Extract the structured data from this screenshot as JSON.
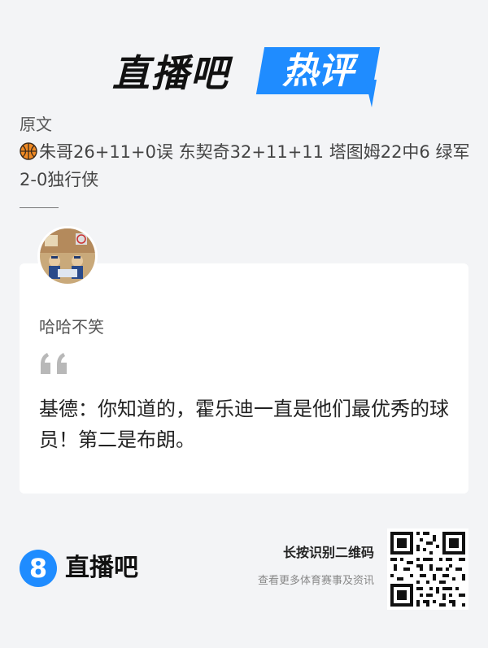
{
  "header": {
    "logo_left": "直播吧",
    "logo_right": "热评"
  },
  "original": {
    "label": "原文",
    "body": "朱哥26+11+0误 东契奇32+11+11 塔图姆22中6 绿军2-0独行侠",
    "icon": "basketball-icon"
  },
  "card": {
    "username": "哈哈不笑",
    "quote_icon": "quote-icon",
    "comment": "基德：你知道的，霍乐迪一直是他们最优秀的球员！第二是布朗。"
  },
  "footer": {
    "logo_number": "8",
    "logo_text": "直播吧",
    "hint_title": "长按识别二维码",
    "hint_sub": "查看更多体育赛事及资讯"
  },
  "colors": {
    "accent": "#1f8cff",
    "background": "#f3f4f6",
    "card": "#ffffff"
  }
}
